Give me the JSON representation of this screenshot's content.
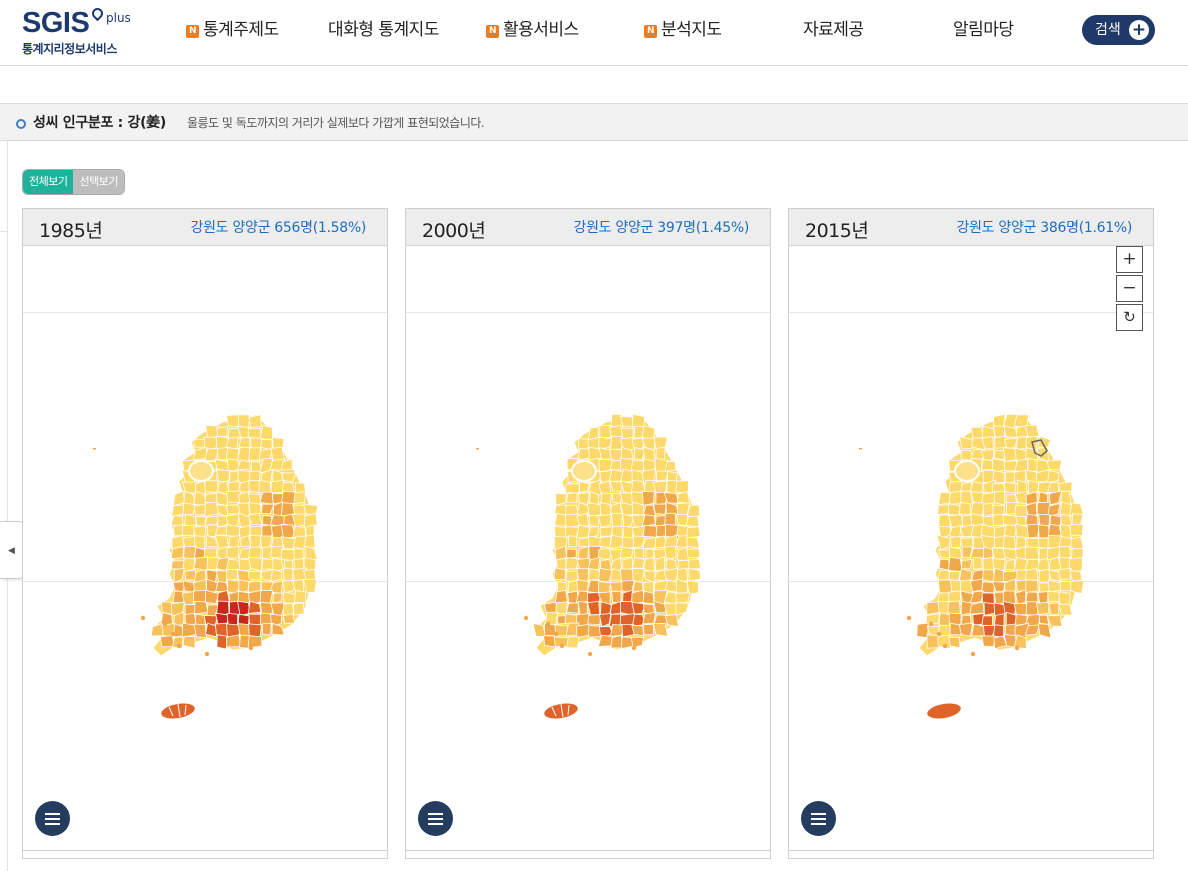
{
  "header": {
    "logo_main": "SGIS",
    "logo_plus": "plus",
    "logo_sub": "통계지리정보서비스",
    "nav": [
      {
        "label": "통계주제도",
        "new": true
      },
      {
        "label": "대화형 통계지도",
        "new": false
      },
      {
        "label": "활용서비스",
        "new": true
      },
      {
        "label": "분석지도",
        "new": true
      },
      {
        "label": "자료제공",
        "new": false
      },
      {
        "label": "알림마당",
        "new": false
      }
    ],
    "new_badge": "N",
    "search_label": "검색"
  },
  "titlebar": {
    "title": "성씨 인구분포 : 강(姜)",
    "note": "울릉도 및 독도까지의 거리가 실제보다 가깝게 표현되었습니다."
  },
  "toggle": {
    "all_label": "전체보기",
    "select_label": "선택보기",
    "active": "전체보기"
  },
  "panels": [
    {
      "year": "1985년",
      "region": "강원도 양양군 656명(1.58%)"
    },
    {
      "year": "2000년",
      "region": "강원도 양양군 397명(1.45%)"
    },
    {
      "year": "2015년",
      "region": "강원도 양양군 386명(1.61%)"
    }
  ],
  "zoom": {
    "in": "+",
    "out": "−",
    "reset": "↻"
  },
  "colors": {
    "brand": "#1d3a6e",
    "new_badge": "#f07c1c",
    "toggle_active": "#1eb29a",
    "region_text": "#1b6fc0",
    "map_low": "#fcd96b",
    "map_mid": "#f0a84a",
    "map_high": "#e0642a",
    "map_max": "#c8281c"
  }
}
